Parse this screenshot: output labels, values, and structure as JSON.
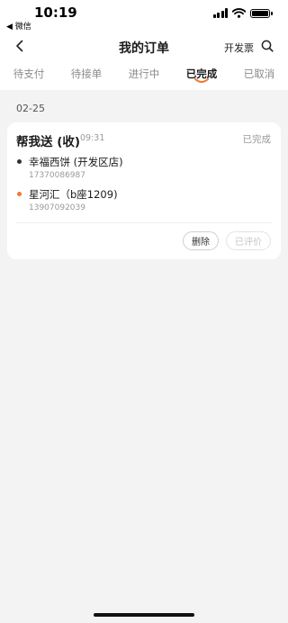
{
  "status_bar": {
    "time": "10:19",
    "back_app": "◀ 微信"
  },
  "nav": {
    "title": "我的订单",
    "invoice": "开发票"
  },
  "tabs": [
    {
      "label": "待支付"
    },
    {
      "label": "待接单"
    },
    {
      "label": "进行中"
    },
    {
      "label": "已完成",
      "active": true
    },
    {
      "label": "已取消"
    }
  ],
  "order_group": {
    "date": "02-25"
  },
  "order": {
    "title": "帮我送 (收)",
    "time": "09:31",
    "status": "已完成",
    "pickup": {
      "address": "幸福西饼 (开发区店)",
      "phone": "17370086987"
    },
    "dropoff": {
      "address": "星河汇（b座1209)",
      "phone": "13907092039"
    },
    "delete_label": "删除",
    "review_label": "已评价"
  },
  "colors": {
    "accent": "#f07a2e",
    "background": "#f3f3f3",
    "card": "#ffffff"
  }
}
